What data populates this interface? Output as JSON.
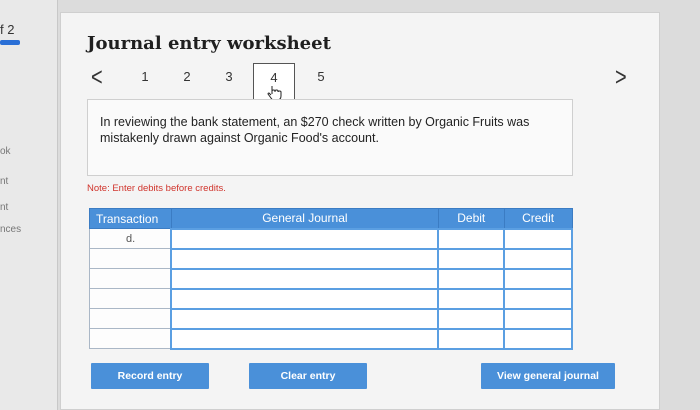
{
  "sidebar": {
    "tab_number": "f 2",
    "labels": [
      "ok",
      "nt",
      "nt",
      "nces"
    ]
  },
  "worksheet": {
    "title": "Journal entry worksheet",
    "pager": {
      "prev": "<",
      "next": ">",
      "pages": [
        "1",
        "2",
        "3",
        "4",
        "5"
      ],
      "current": "4"
    },
    "scenario": "In reviewing the bank statement, an $270 check written by Organic Fruits was mistakenly drawn against Organic Food's account.",
    "note": "Note: Enter debits before credits."
  },
  "table": {
    "headers": {
      "transaction": "Transaction",
      "general_journal": "General Journal",
      "debit": "Debit",
      "credit": "Credit"
    },
    "rows": [
      {
        "transaction": "d.",
        "general_journal": "",
        "debit": "",
        "credit": ""
      },
      {
        "transaction": "",
        "general_journal": "",
        "debit": "",
        "credit": ""
      },
      {
        "transaction": "",
        "general_journal": "",
        "debit": "",
        "credit": ""
      },
      {
        "transaction": "",
        "general_journal": "",
        "debit": "",
        "credit": ""
      },
      {
        "transaction": "",
        "general_journal": "",
        "debit": "",
        "credit": ""
      },
      {
        "transaction": "",
        "general_journal": "",
        "debit": "",
        "credit": ""
      }
    ]
  },
  "buttons": {
    "record": "Record entry",
    "clear": "Clear entry",
    "view": "View general journal"
  },
  "colors": {
    "accent": "#4a90d9",
    "note": "#d0342c"
  }
}
